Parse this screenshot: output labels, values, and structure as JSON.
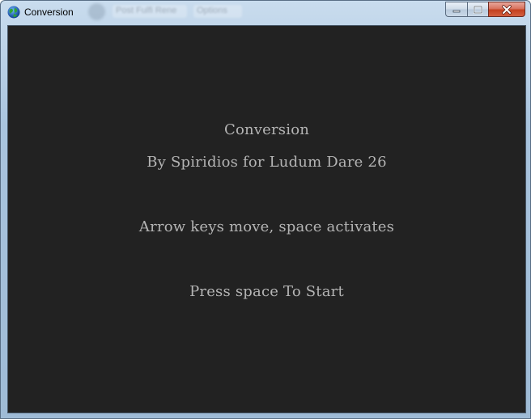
{
  "window": {
    "title": "Conversion",
    "icon": "globe-icon",
    "buttons": {
      "minimize": "minimize-icon",
      "maximize": "maximize-icon",
      "close": "close-icon"
    }
  },
  "background_taskbar": {
    "items": [
      "Post Fulfi Rene",
      "Options"
    ]
  },
  "game": {
    "title": "Conversion",
    "credit": "By Spiridios for Ludum Dare 26",
    "instructions": "Arrow keys move, space activates",
    "prompt": "Press space To Start"
  },
  "colors": {
    "game_background": "#222222",
    "game_text": "#b4b4b4",
    "close_button": "#c4401f"
  }
}
